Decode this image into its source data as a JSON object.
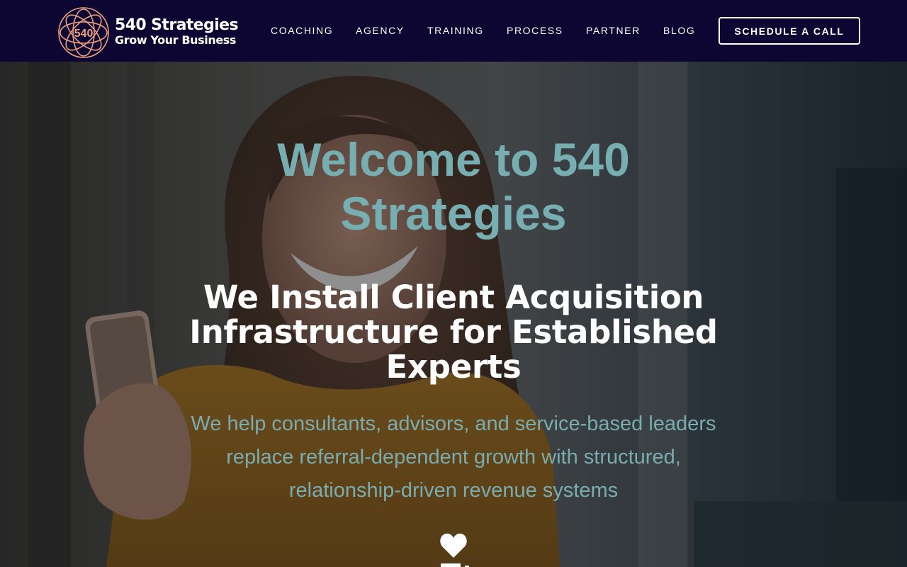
{
  "brand": {
    "mark_text": "540",
    "name": "540 Strategies",
    "tagline": "Grow Your Business",
    "accent_color": "#e9a07e"
  },
  "nav": {
    "items": [
      {
        "label": "COACHING"
      },
      {
        "label": "AGENCY"
      },
      {
        "label": "TRAINING"
      },
      {
        "label": "PROCESS"
      },
      {
        "label": "PARTNER"
      },
      {
        "label": "BLOG"
      }
    ],
    "cta_label": "SCHEDULE A CALL"
  },
  "hero": {
    "title": "Welcome to 540 Strategies",
    "headline": "We Install Client Acquisition Infrastructure for Established Experts",
    "subtext": "We help consultants, advisors, and service-based leaders replace referral-dependent growth with structured, relationship-driven revenue systems",
    "title_color": "#77aeb1",
    "subtext_color": "#7aacaf",
    "icon": "heart-icon"
  },
  "colors": {
    "header_bg": "#0d0632",
    "text_white": "#ffffff"
  }
}
